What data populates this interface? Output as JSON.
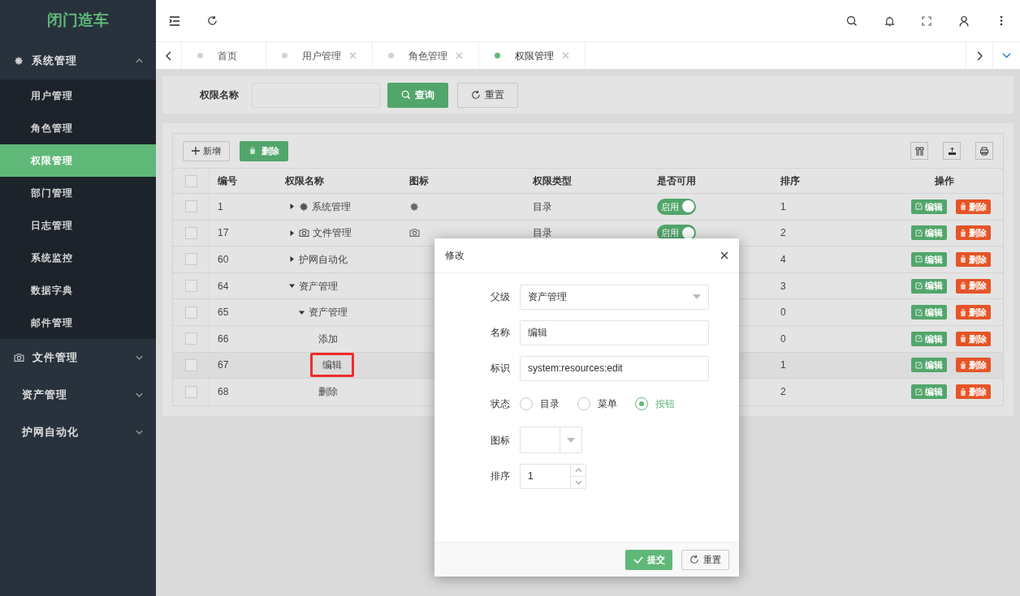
{
  "sidebar": {
    "logo": "闭门造车",
    "menu": [
      {
        "label": "系统管理",
        "kind": "gear",
        "expanded": true,
        "children": [
          {
            "label": "用户管理",
            "selected": false
          },
          {
            "label": "角色管理",
            "selected": false
          },
          {
            "label": "权限管理",
            "selected": true
          },
          {
            "label": "部门管理",
            "selected": false
          },
          {
            "label": "日志管理",
            "selected": false
          },
          {
            "label": "系统监控",
            "selected": false
          },
          {
            "label": "数据字典",
            "selected": false
          },
          {
            "label": "邮件管理",
            "selected": false
          }
        ]
      },
      {
        "label": "文件管理",
        "kind": "camera",
        "expanded": false
      },
      {
        "label": "资产管理",
        "expanded": false
      },
      {
        "label": "护网自动化",
        "expanded": false
      }
    ]
  },
  "tabs": [
    {
      "label": "首页",
      "selected": false,
      "closable": false
    },
    {
      "label": "用户管理",
      "selected": false,
      "closable": true
    },
    {
      "label": "角色管理",
      "selected": false,
      "closable": true
    },
    {
      "label": "权限管理",
      "selected": true,
      "closable": true
    }
  ],
  "search": {
    "label": "权限名称",
    "query_button": "查询",
    "reset_button": "重置"
  },
  "toolbar": {
    "add_button": "新增",
    "delete_button": "删除"
  },
  "table": {
    "header_checked": false,
    "columns": [
      "编号",
      "权限名称",
      "图标",
      "权限类型",
      "是否可用",
      "排序",
      "操作"
    ],
    "rows": [
      {
        "id": "1",
        "name": "系统管理",
        "kind": "gear",
        "expanded": false,
        "type": "目录",
        "enabled": true,
        "toggle_label": "启用",
        "order": "1",
        "checked": false,
        "highlighted": false,
        "actions": [
          "编辑",
          "删除"
        ]
      },
      {
        "id": "17",
        "name": "文件管理",
        "kind": "camera",
        "expanded": false,
        "type": "目录",
        "enabled": true,
        "toggle_label": "启用",
        "order": "2",
        "checked": false,
        "highlighted": false,
        "actions": [
          "编辑",
          "删除"
        ]
      },
      {
        "id": "60",
        "name": "护网自动化",
        "expanded": false,
        "order": "4",
        "checked": false,
        "highlighted": false,
        "actions": [
          "编辑",
          "删除"
        ]
      },
      {
        "id": "64",
        "name": "资产管理",
        "expanded": true,
        "order": "3",
        "checked": false,
        "highlighted": false,
        "actions": [
          "编辑",
          "删除"
        ],
        "children": [
          {
            "id": "65",
            "name": "资产管理",
            "expanded": true,
            "order": "0",
            "checked": false,
            "highlighted": false,
            "actions": [
              "编辑",
              "删除"
            ],
            "children": [
              {
                "id": "66",
                "name": "添加",
                "order": "0",
                "checked": false,
                "highlighted": false,
                "actions": [
                  "编辑",
                  "删除"
                ]
              },
              {
                "id": "67",
                "name": "编辑",
                "order": "1",
                "checked": false,
                "highlighted": true,
                "actions": [
                  "编辑",
                  "删除"
                ]
              },
              {
                "id": "68",
                "name": "删除",
                "order": "2",
                "checked": false,
                "highlighted": false,
                "actions": [
                  "编辑",
                  "删除"
                ]
              }
            ]
          }
        ]
      }
    ]
  },
  "dialog": {
    "title": "修改",
    "fields": [
      {
        "kind": "select",
        "label": "父级",
        "value": "资产管理"
      },
      {
        "kind": "text",
        "label": "名称",
        "value": "编辑"
      },
      {
        "kind": "text",
        "label": "标识",
        "value": "system:resources:edit"
      },
      {
        "kind": "radio",
        "label": "状态",
        "options": [
          {
            "label": "目录",
            "selected": false
          },
          {
            "label": "菜单",
            "selected": false
          },
          {
            "label": "按钮",
            "selected": true
          }
        ]
      },
      {
        "kind": "icon_select",
        "label": "图标"
      },
      {
        "kind": "number",
        "label": "排序",
        "value": "1"
      }
    ],
    "submit_button": "提交",
    "reset_button": "重置"
  }
}
